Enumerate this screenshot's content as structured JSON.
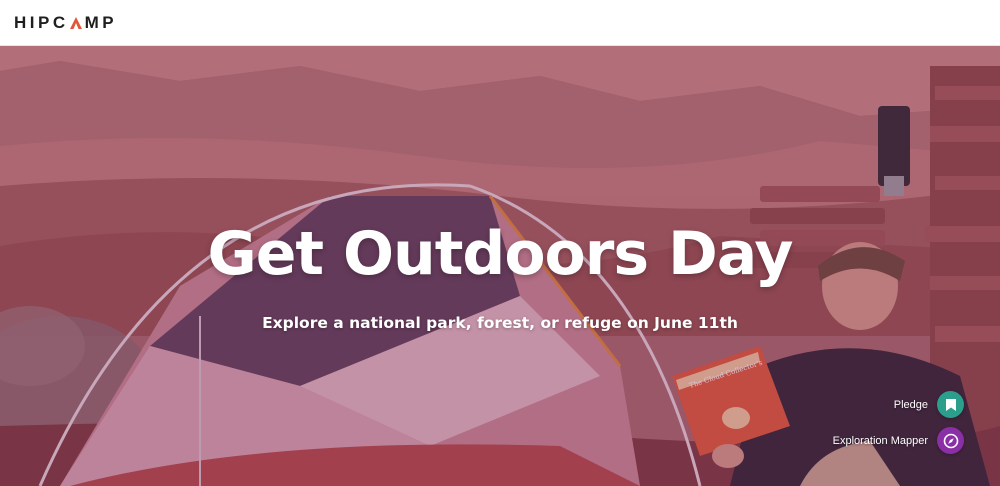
{
  "header": {
    "logo_text_left": "HIPC",
    "logo_text_right": "MP"
  },
  "hero": {
    "title": "Get Outdoors Day",
    "subtitle": "Explore a national park, forest, or refuge on June 11th",
    "book_title": "The Cloud Collector's"
  },
  "actions": [
    {
      "label": "Pledge",
      "icon": "bookmark-icon",
      "color": "#2b9e8c"
    },
    {
      "label": "Exploration Mapper",
      "icon": "compass-icon",
      "color": "#8a2fa6"
    }
  ],
  "colors": {
    "logo_accent": "#e0563a",
    "pledge": "#2b9e8c",
    "mapper": "#8a2fa6"
  }
}
